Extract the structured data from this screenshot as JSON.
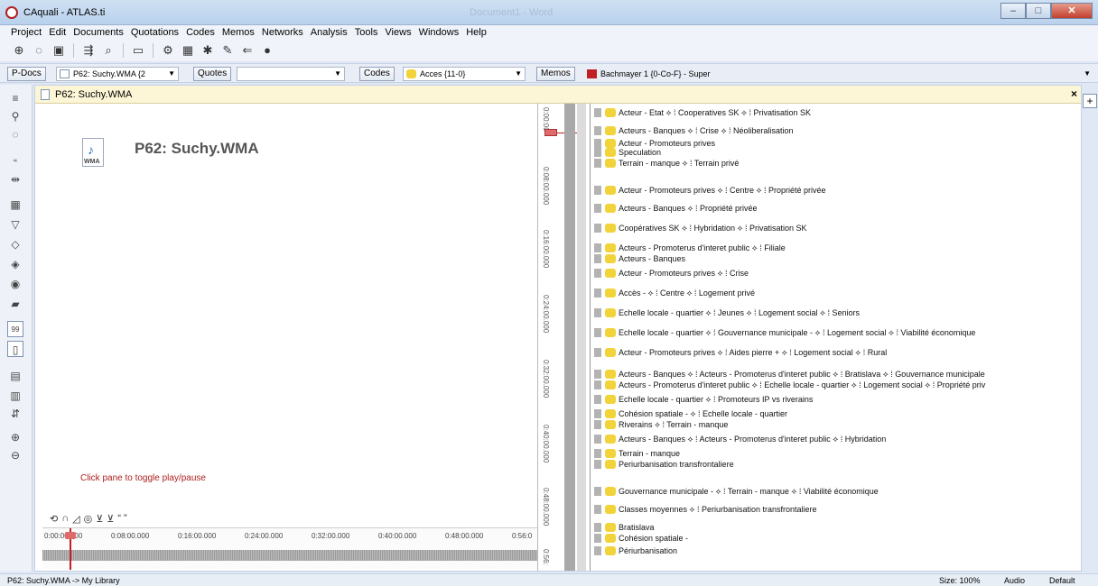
{
  "window": {
    "title": "CAquali - ATLAS.ti",
    "ghost_title": "Document1 - Word",
    "minimize": "–",
    "maximize": "□",
    "close": "✕"
  },
  "menu": [
    "Project",
    "Edit",
    "Documents",
    "Quotations",
    "Codes",
    "Memos",
    "Networks",
    "Analysis",
    "Tools",
    "Views",
    "Windows",
    "Help"
  ],
  "managers": {
    "pdocs_label": "P-Docs",
    "pdoc_selected": "P62: Suchy.WMA {2",
    "quotes_label": "Quotes",
    "quotes_selected": "",
    "codes_label": "Codes",
    "code_selected": "Acces {11-0}",
    "memos_label": "Memos",
    "memo_selected": "Bachmayer 1 {0-Co-F} - Super"
  },
  "document": {
    "tab_title": "P62: Suchy.WMA",
    "close": "×",
    "media_title": "P62: Suchy.WMA",
    "media_ext": "WMA",
    "hint": "Click pane to toggle play/pause",
    "timeline_labels": [
      "0:00:00.000",
      "0:08:00.000",
      "0:16:00.000",
      "0:24:00.000",
      "0:32:00.000",
      "0:40:00.000",
      "0:48:00.000",
      "0:56:0"
    ],
    "ruler_labels": [
      "0:00:00",
      "0:08:00.000",
      "0:16:00.000",
      "0:24:00.000",
      "0:32:00.000",
      "0:40:00.000",
      "0:48:00.000",
      "0:56:"
    ],
    "quote_mark": "“ ”"
  },
  "codes": [
    "Acteur - Etat  ⟡ ⁞ Cooperatives SK  ⟡ ⁞ Privatisation SK",
    "Acteurs - Banques  ⟡ ⁞ Crise  ⟡ ⁞ Néoliberalisation",
    "Acteur - Promoteurs prives",
    "Speculation",
    "Terrain - manque  ⟡ ⁞ Terrain privé",
    "Acteur - Promoteurs prives  ⟡ ⁞ Centre  ⟡ ⁞ Propriété privée",
    "Acteurs - Banques  ⟡ ⁞ Propriété privée",
    "Coopératives SK  ⟡ ⁞ Hybridation  ⟡ ⁞ Privatisation SK",
    "Acteurs - Promoterus d'interet public  ⟡ ⁞ Filiale",
    "Acteurs - Banques",
    "Acteur - Promoteurs prives  ⟡ ⁞ Crise",
    "Accès -  ⟡ ⁞ Centre  ⟡ ⁞ Logement privé",
    "Echelle locale - quartier  ⟡ ⁞ Jeunes  ⟡ ⁞ Logement social  ⟡ ⁞ Seniors",
    "Echelle locale - quartier  ⟡ ⁞ Gouvernance municipale -  ⟡ ⁞ Logement social  ⟡ ⁞ Viabilité économique",
    "Acteur - Promoteurs prives  ⟡ ⁞ Aides pierre +  ⟡ ⁞ Logement social  ⟡ ⁞ Rural",
    "Acteurs - Banques  ⟡ ⁞ Acteurs - Promoterus d'interet public  ⟡ ⁞ Bratislava  ⟡ ⁞ Gouvernance municipale",
    "Acteurs - Promoterus d'interet public  ⟡ ⁞ Echelle locale - quartier  ⟡ ⁞ Logement social  ⟡ ⁞ Propriété priv",
    "Echelle locale - quartier  ⟡ ⁞ Promoteurs IP vs riverains",
    "Cohésion spatiale -  ⟡ ⁞ Echelle locale - quartier",
    "Riverains  ⟡ ⁞ Terrain - manque",
    "Acteurs - Banques  ⟡ ⁞ Acteurs - Promoterus d'interet public  ⟡ ⁞ Hybridation",
    "Terrain - manque",
    "Periurbanisation transfrontaliere",
    "Gouvernance municipale -  ⟡ ⁞ Terrain - manque  ⟡ ⁞ Viabilité économique",
    "Classes moyennes  ⟡ ⁞ Periurbanisation transfrontaliere",
    "Bratislava",
    "Cohésion spatiale -",
    "Périurbanisation"
  ],
  "status": {
    "left": "P62: Suchy.WMA -> My Library",
    "size": "Size: 100%",
    "audio": "Audio",
    "default": "Default"
  },
  "colors": {
    "chip": "#f2d33a",
    "accent": "#c02020"
  }
}
